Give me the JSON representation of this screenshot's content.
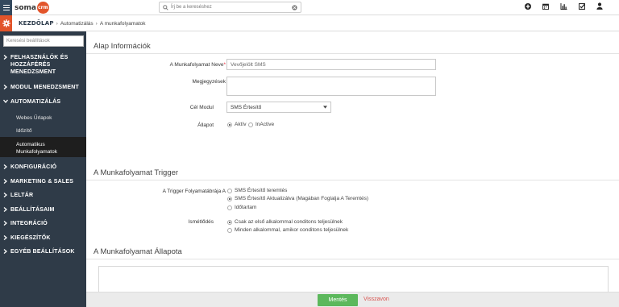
{
  "brand": {
    "name": "soma",
    "badge": "crm"
  },
  "search": {
    "placeholder": "Írj be a kereséshez"
  },
  "top_icons": [
    "plus-circle-icon",
    "calendar-icon",
    "bar-chart-icon",
    "checkbox-icon",
    "user-icon"
  ],
  "breadcrumb": {
    "home": "KEZDŐLAP",
    "items": [
      "Automatizálás",
      "A munkafolyamatok"
    ]
  },
  "sidebar": {
    "search_placeholder": "Keresési beállítások",
    "items": [
      {
        "label": "FELHASZNÁLÓK ÉS HOZZÁFÉRÉS MENEDZSMENT",
        "expanded": false
      },
      {
        "label": "MODUL MENEDZSMENT",
        "expanded": false
      },
      {
        "label": "AUTOMATIZÁLÁS",
        "expanded": true
      },
      {
        "label": "KONFIGURÁCIÓ",
        "expanded": false
      },
      {
        "label": "MARKETING & SALES",
        "expanded": false
      },
      {
        "label": "LELTÁR",
        "expanded": false
      },
      {
        "label": "BEÁLLÍTÁSAIM",
        "expanded": false
      },
      {
        "label": "INTEGRÁCIÓ",
        "expanded": false
      },
      {
        "label": "KIEGÉSZÍTŐK",
        "expanded": false
      },
      {
        "label": "EGYÉB BEÁLLÍTÁSOK",
        "expanded": false
      }
    ],
    "subitems": [
      {
        "label": "Webes Űrlapok"
      },
      {
        "label": "Időzítő"
      },
      {
        "label": "Automatikus Munkafolyamatok",
        "active": true
      }
    ]
  },
  "basic": {
    "title": "Alap Információk",
    "name_label": "A Munkafolyamat Neve",
    "name_required": "*",
    "name_value": "Vevőjelölt SMS",
    "notes_label": "Megjegyzések",
    "notes_value": "",
    "module_label": "Cél Modul",
    "module_value": "SMS Értesítő",
    "state_label": "Állapot",
    "state_options": [
      {
        "label": "Aktív",
        "selected": true
      },
      {
        "label": "InActive",
        "selected": false
      }
    ]
  },
  "trigger": {
    "title": "A Munkafolyamat Trigger",
    "flow_label": "A Trigger Folyamatábrája A",
    "flow_options": [
      {
        "label": "SMS Értesítő teremtés",
        "selected": false
      },
      {
        "label": "SMS Értesítő Aktualizálva  (Magában Foglalja A Teremtés)",
        "selected": true
      },
      {
        "label": "Időtartam",
        "selected": false
      }
    ],
    "repeat_label": "Ismétlődés",
    "repeat_options": [
      {
        "label": "Csak az első alkalommal conditons teljesülnek",
        "selected": true
      },
      {
        "label": "Minden alkalommal, amikor conditons teljesülnek",
        "selected": false
      }
    ]
  },
  "state_section": {
    "title": "A Munkafolyamat Állapota"
  },
  "footer": {
    "save_label": "Mentés",
    "cancel_label": "Visszavon"
  },
  "colors": {
    "sidebar": "#2f3b48",
    "accent": "#e2542a",
    "save": "#5cb85c",
    "cancel": "#d9534f"
  }
}
